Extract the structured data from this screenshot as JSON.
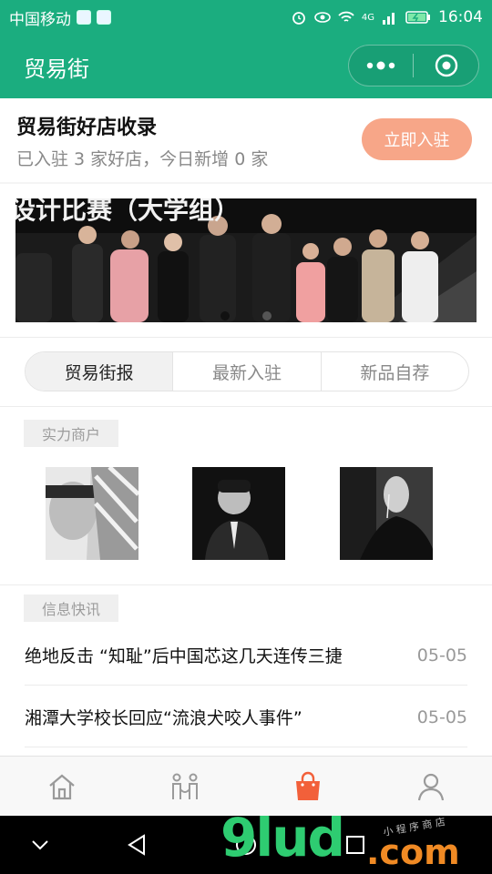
{
  "status_bar": {
    "carrier": "中国移动",
    "network": "4G",
    "time": "16:04"
  },
  "header": {
    "title": "贸易街",
    "more_icon": "more-dots-icon",
    "close_icon": "target-close-icon"
  },
  "store_banner": {
    "title": "贸易街好店收录",
    "subtitle": "已入驻 3 家好店，今日新增 0 家",
    "join_label": "立即入驻"
  },
  "carousel": {
    "banner_text": "设计比赛（大学组）",
    "dot_count": 2,
    "active_dot": 0
  },
  "tabs": [
    {
      "label": "贸易街报",
      "active": true
    },
    {
      "label": "最新入驻",
      "active": false
    },
    {
      "label": "新品自荐",
      "active": false
    }
  ],
  "merchants": {
    "label": "实力商户",
    "avatars": [
      "avatar-1",
      "avatar-2",
      "avatar-3"
    ]
  },
  "news": {
    "label": "信息快讯",
    "items": [
      {
        "title": "绝地反击 “知耻”后中国芯这几天连传三捷",
        "date": "05-05"
      },
      {
        "title": "湘潭大学校长回应“流浪犬咬人事件”",
        "date": "05-05"
      }
    ]
  },
  "tabbar": [
    {
      "icon": "home-icon",
      "active": false
    },
    {
      "icon": "people-icon",
      "active": false
    },
    {
      "icon": "shopping-bag-icon",
      "active": true
    },
    {
      "icon": "user-icon",
      "active": false
    }
  ],
  "colors": {
    "brand_green": "#1bad7f",
    "join_button": "#f7a688",
    "active_tab_icon": "#f2603a"
  },
  "watermark": {
    "logo": "9lud",
    "domain": ".com",
    "tagline": "小 程 序 商 店"
  }
}
